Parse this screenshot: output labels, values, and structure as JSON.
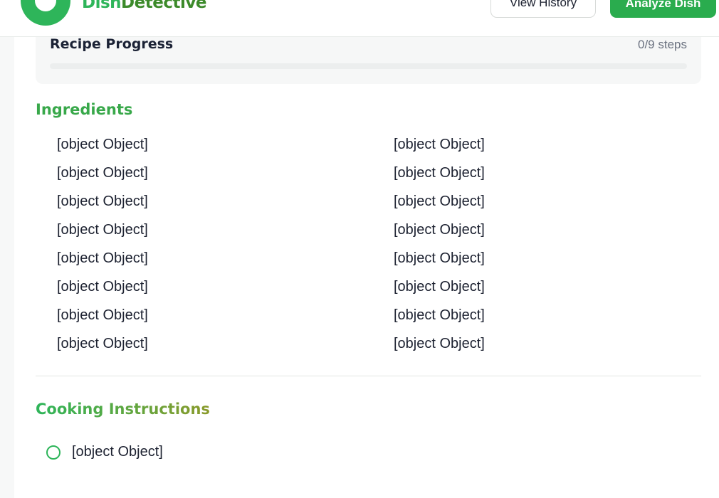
{
  "header": {
    "brand_part1": "Dish",
    "brand_part2": "Detective",
    "history_label": "View History",
    "analyze_label": "Analyze Dish"
  },
  "progress": {
    "title": "Recipe Progress",
    "count_text": "0/9 steps",
    "completed_fraction": 0
  },
  "ingredients": {
    "title": "Ingredients",
    "items": [
      "[object Object]",
      "[object Object]",
      "[object Object]",
      "[object Object]",
      "[object Object]",
      "[object Object]",
      "[object Object]",
      "[object Object]",
      "[object Object]",
      "[object Object]",
      "[object Object]",
      "[object Object]",
      "[object Object]",
      "[object Object]",
      "[object Object]",
      "[object Object]"
    ]
  },
  "instructions": {
    "title": "Cooking Instructions",
    "steps": [
      "[object Object]"
    ]
  },
  "colors": {
    "accent": "#2eb55a",
    "button_green": "#2aac4e"
  }
}
